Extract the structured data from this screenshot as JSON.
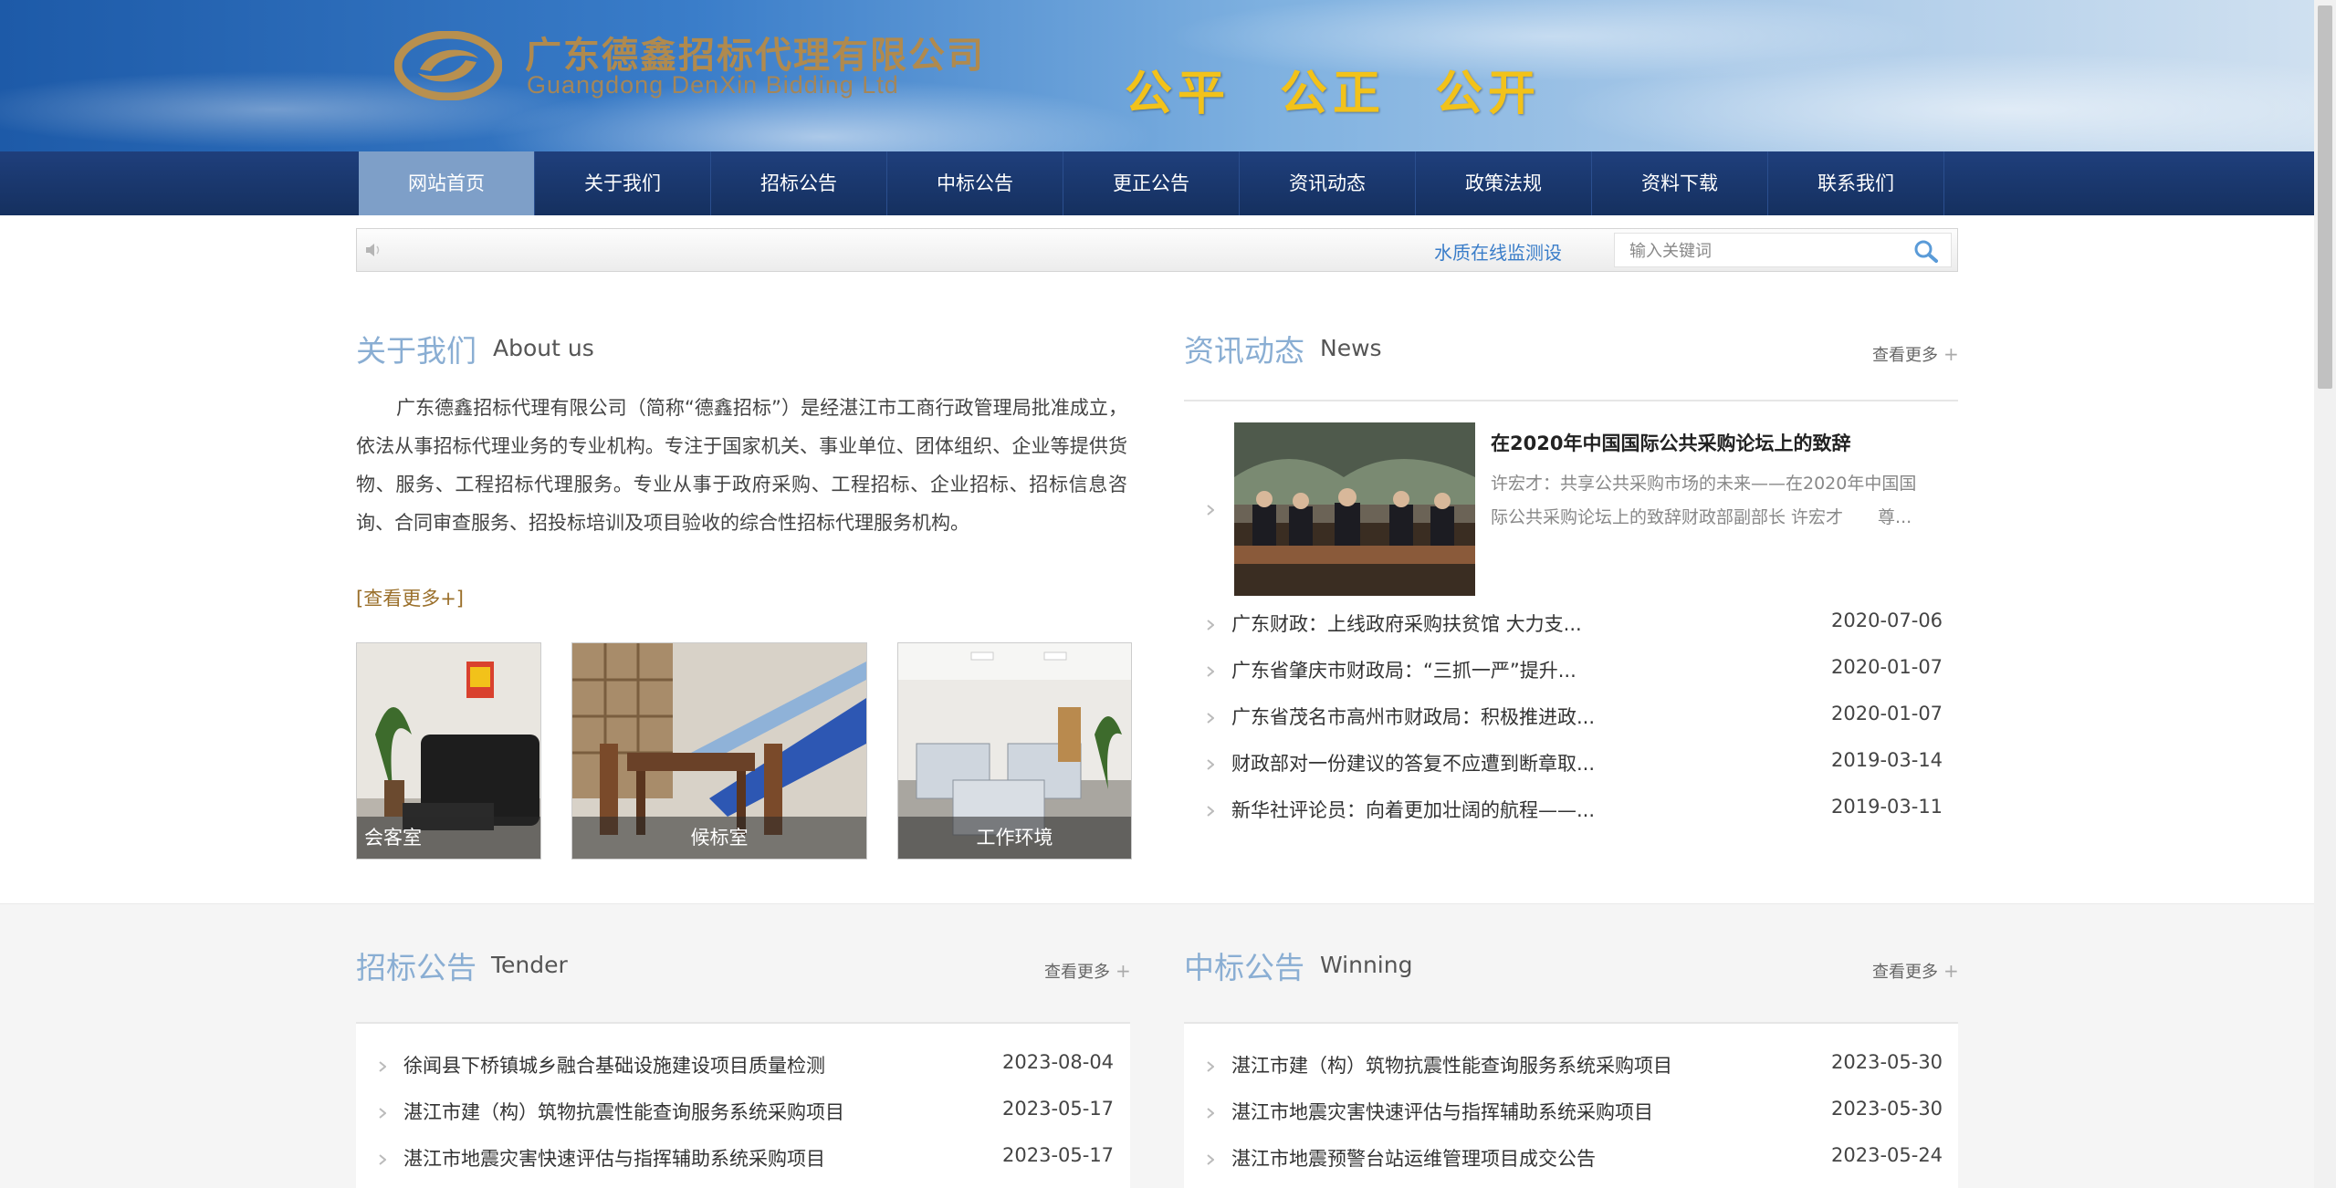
{
  "header": {
    "company_cn": "广东德鑫招标代理有限公司",
    "company_en": "Guangdong DenXin Bidding Ltd",
    "slogans": [
      "公平",
      "公正",
      "公开"
    ]
  },
  "nav": {
    "items": [
      {
        "label": "网站首页",
        "active": true
      },
      {
        "label": "关于我们"
      },
      {
        "label": "招标公告"
      },
      {
        "label": "中标公告"
      },
      {
        "label": "更正公告"
      },
      {
        "label": "资讯动态"
      },
      {
        "label": "政策法规"
      },
      {
        "label": "资料下载"
      },
      {
        "label": "联系我们"
      }
    ]
  },
  "notice_bar": {
    "scrolling_text": "水质在线监测设",
    "search_placeholder": "输入关键词"
  },
  "about": {
    "title": "关于我们",
    "subtitle": "About us",
    "text": "广东德鑫招标代理有限公司（简称“德鑫招标”）是经湛江市工商行政管理局批准成立，依法从事招标代理业务的专业机构。专注于国家机关、事业单位、团体组织、企业等提供货物、服务、工程招标代理服务。专业从事于政府采购、工程招标、企业招标、招标信息咨询、合同审查服务、招投标培训及项目验收的综合性招标代理服务机构。",
    "more": "[查看更多+]",
    "photos": [
      {
        "caption": "会客室"
      },
      {
        "caption": "候标室"
      },
      {
        "caption": "工作环境"
      }
    ]
  },
  "news": {
    "title": "资讯动态",
    "subtitle": "News",
    "more": "查看更多",
    "featured": {
      "title": "在2020年中国国际公共采购论坛上的致辞",
      "desc": "许宏才：共享公共采购市场的未来——在2020年中国国际公共采购论坛上的致辞财政部副部长 许宏才　　尊..."
    },
    "items": [
      {
        "title": "广东财政：上线政府采购扶贫馆 大力支...",
        "date": "2020-07-06"
      },
      {
        "title": "广东省肇庆市财政局：“三抓一严”提升...",
        "date": "2020-01-07"
      },
      {
        "title": "广东省茂名市高州市财政局：积极推进政...",
        "date": "2020-01-07"
      },
      {
        "title": "财政部对一份建议的答复不应遭到断章取...",
        "date": "2019-03-14"
      },
      {
        "title": "新华社评论员：向着更加壮阔的航程——...",
        "date": "2019-03-11"
      }
    ]
  },
  "tender": {
    "title": "招标公告",
    "subtitle": "Tender",
    "more": "查看更多",
    "items": [
      {
        "title": "徐闻县下桥镇城乡融合基础设施建设项目质量检测",
        "date": "2023-08-04"
      },
      {
        "title": "湛江市建（构）筑物抗震性能查询服务系统采购项目",
        "date": "2023-05-17"
      },
      {
        "title": "湛江市地震灾害快速评估与指挥辅助系统采购项目",
        "date": "2023-05-17"
      }
    ]
  },
  "winning": {
    "title": "中标公告",
    "subtitle": "Winning",
    "more": "查看更多",
    "items": [
      {
        "title": "湛江市建（构）筑物抗震性能查询服务系统采购项目",
        "date": "2023-05-30"
      },
      {
        "title": "湛江市地震灾害快速评估与指挥辅助系统采购项目",
        "date": "2023-05-30"
      },
      {
        "title": "湛江市地震预警台站运维管理项目成交公告",
        "date": "2023-05-24"
      }
    ]
  },
  "colors": {
    "nav_bg": "#15305f",
    "nav_active": "#7e9fc8",
    "section_title": "#8aaed3",
    "slogan": "#f2c21a",
    "link_brown": "#9a6f2a"
  }
}
